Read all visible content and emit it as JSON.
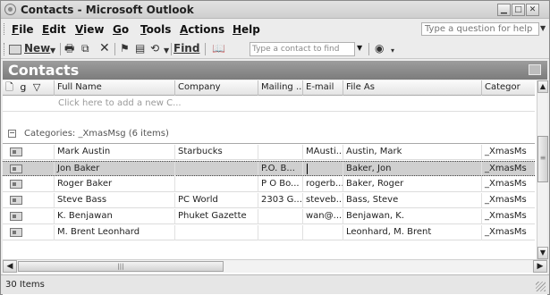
{
  "window": {
    "title": "Contacts - Microsoft Outlook"
  },
  "menu": {
    "items": [
      {
        "label": "File",
        "accel": "F",
        "rest": "ile"
      },
      {
        "label": "Edit",
        "accel": "E",
        "rest": "dit"
      },
      {
        "label": "View",
        "accel": "V",
        "rest": "iew"
      },
      {
        "label": "Go",
        "accel": "G",
        "rest": "o"
      },
      {
        "label": "Tools",
        "accel": "T",
        "rest": "ools"
      },
      {
        "label": "Actions",
        "accel": "A",
        "rest": "ctions"
      },
      {
        "label": "Help",
        "accel": "H",
        "rest": "elp"
      }
    ],
    "help_placeholder": "Type a question for help"
  },
  "toolbar": {
    "new_label": "New",
    "find_label": "Find",
    "contact_find_placeholder": "Type a contact to find",
    "icons": [
      "new-contact-icon",
      "print-icon",
      "move-to-folder-icon",
      "delete-icon",
      "flag-icon",
      "categories-icon",
      "send-receive-icon",
      "find-icon",
      "address-book-icon",
      "help-icon"
    ]
  },
  "header": {
    "title": "Contacts"
  },
  "columns": {
    "icons": "🗋 g ▽",
    "full_name": "Full Name",
    "company": "Company",
    "mailing": "Mailing ...",
    "email": "E-mail",
    "file_as": "File As",
    "categories": "Categor"
  },
  "add_row": {
    "text": "Click here to add a new C..."
  },
  "group": {
    "toggle": "−",
    "label": "Categories: _XmasMsg (6 items)"
  },
  "contacts": [
    {
      "full_name": "Mark Austin",
      "company": "Starbucks",
      "mailing": "",
      "email": "MAusti...",
      "file_as": "Austin, Mark",
      "categories": "_XmasMs"
    },
    {
      "full_name": "Jon Baker",
      "company": "",
      "mailing": "P.O. B...",
      "email": "",
      "file_as": "Baker, Jon",
      "categories": "_XmasMs"
    },
    {
      "full_name": "Roger Baker",
      "company": "",
      "mailing": "P O Bo...",
      "email": "rogerb...",
      "file_as": "Baker, Roger",
      "categories": "_XmasMs"
    },
    {
      "full_name": "Steve Bass",
      "company": "PC World",
      "mailing": "2303 G...",
      "email": "steveb...",
      "file_as": "Bass, Steve",
      "categories": "_XmasMs"
    },
    {
      "full_name": "K. Benjawan",
      "company": "Phuket Gazette",
      "mailing": "",
      "email": "wan@...",
      "file_as": "Benjawan, K.",
      "categories": "_XmasMs"
    },
    {
      "full_name": "M. Brent Leonhard",
      "company": "",
      "mailing": "",
      "email": "",
      "file_as": "Leonhard, M. Brent",
      "categories": "_XmasMs"
    }
  ],
  "selected_index": 1,
  "status": {
    "text": "30 Items"
  },
  "colors": {
    "header_band": "#8a8a8a",
    "selected_row": "#cfcfcf"
  }
}
